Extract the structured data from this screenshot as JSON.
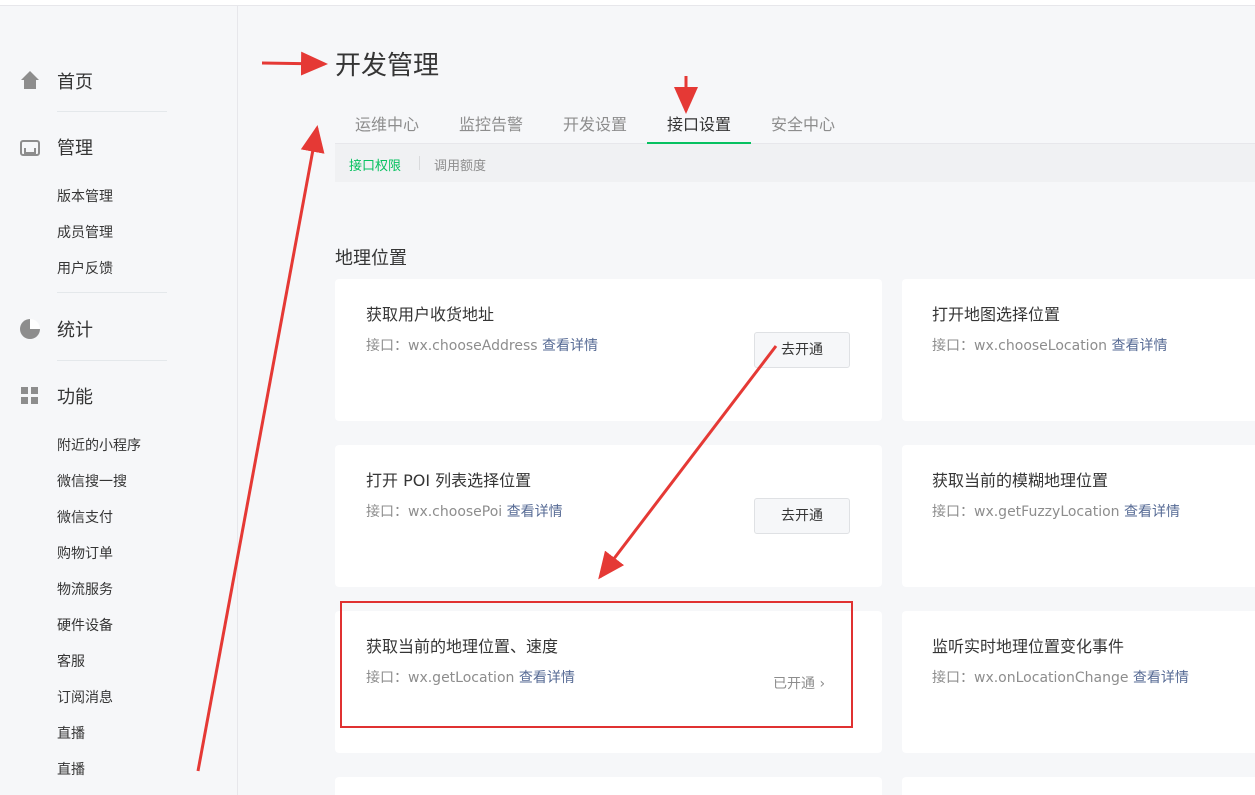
{
  "sidebar": {
    "home": {
      "label": "首页",
      "icon": "home-icon"
    },
    "manage": {
      "label": "管理",
      "icon": "inbox-icon",
      "items": [
        "版本管理",
        "成员管理",
        "用户反馈"
      ]
    },
    "stats": {
      "label": "统计",
      "icon": "pie-chart-icon"
    },
    "features": {
      "label": "功能",
      "icon": "grid-icon",
      "items": [
        "附近的小程序",
        "微信搜一搜",
        "微信支付",
        "购物订单",
        "物流服务",
        "硬件设备",
        "客服",
        "订阅消息",
        "直播",
        "直播"
      ]
    }
  },
  "header": {
    "title": "开发管理",
    "tabs": [
      "运维中心",
      "监控告警",
      "开发设置",
      "接口设置",
      "安全中心"
    ],
    "active_tab": "接口设置",
    "subtabs": [
      "接口权限",
      "调用额度"
    ],
    "active_subtab": "接口权限"
  },
  "section": {
    "title": "地理位置"
  },
  "cards": [
    {
      "title": "获取用户收货地址",
      "api_prefix": "接口：",
      "api": "wx.chooseAddress",
      "link": "查看详情",
      "action": "去开通"
    },
    {
      "title": "打开地图选择位置",
      "api_prefix": "接口：",
      "api": "wx.chooseLocation",
      "link": "查看详情"
    },
    {
      "title": "打开 POI 列表选择位置",
      "api_prefix": "接口：",
      "api": "wx.choosePoi",
      "link": "查看详情",
      "action": "去开通"
    },
    {
      "title": "获取当前的模糊地理位置",
      "api_prefix": "接口：",
      "api": "wx.getFuzzyLocation",
      "link": "查看详情"
    },
    {
      "title": "获取当前的地理位置、速度",
      "api_prefix": "接口：",
      "api": "wx.getLocation",
      "link": "查看详情",
      "status": "已开通",
      "status_icon": "chevron-right-icon"
    },
    {
      "title": "监听实时地理位置变化事件",
      "api_prefix": "接口：",
      "api": "wx.onLocationChange",
      "link": "查看详情"
    }
  ],
  "colors": {
    "accent": "#07c160",
    "link": "#576b95",
    "annotation": "#e03131"
  }
}
